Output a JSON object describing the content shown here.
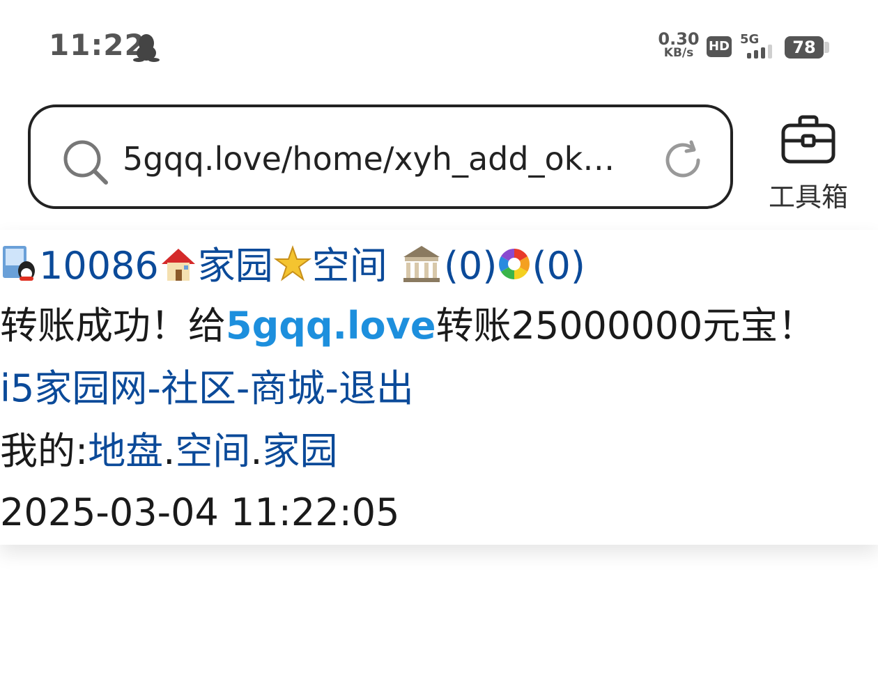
{
  "status_bar": {
    "time": "11:22",
    "net_speed_value": "0.30",
    "net_speed_unit": "KB/s",
    "hd_label": "HD",
    "network_type": "5G",
    "battery_level": "78",
    "icons": [
      "qq-icon",
      "signal-icon",
      "battery-icon"
    ]
  },
  "address_bar": {
    "url": "5gqq.love/home/xyh_add_ok…",
    "icons": [
      "search-icon",
      "reload-icon"
    ]
  },
  "toolbox": {
    "label": "工具箱",
    "icon": "toolbox-icon"
  },
  "page": {
    "user_row": {
      "user_id": "10086",
      "home_link": "家园",
      "space_link": "空间",
      "bank_count": "(0)",
      "photo_count": "(0)",
      "icons": [
        "user-qq-icon",
        "house-icon",
        "star-icon",
        "bank-icon",
        "photo-icon"
      ]
    },
    "transfer_message": {
      "prefix": "转账成功！给",
      "target": "5gqq.love",
      "suffix": "转账25000000元宝！"
    },
    "nav": {
      "site": "i5家园网",
      "community": "社区",
      "mall": "商城",
      "logout": "退出",
      "separator": "-"
    },
    "mine": {
      "label": "我的:",
      "land": "地盘",
      "space": "空间",
      "home": "家园",
      "separator": "."
    },
    "datetime": "2025-03-04 11:22:05"
  },
  "colors": {
    "link": "#0b4a99",
    "highlight": "#1d8fdd",
    "text": "#1a1a1a"
  }
}
